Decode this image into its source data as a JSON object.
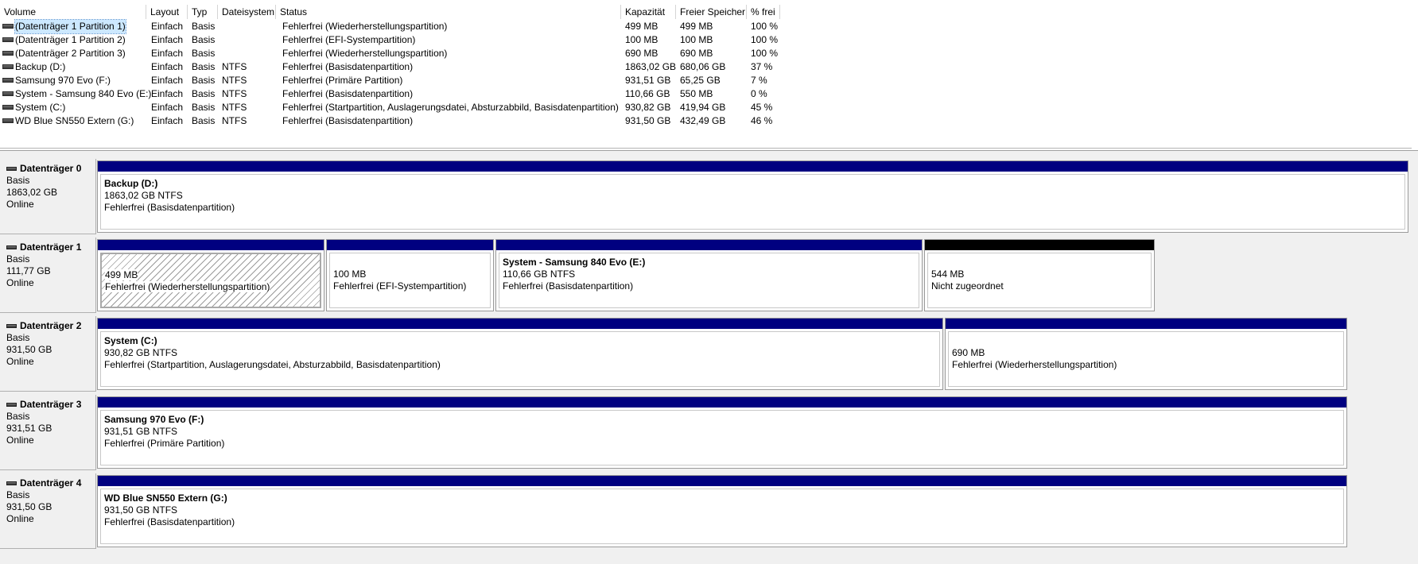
{
  "volume_list": {
    "columns": [
      "Volume",
      "Layout",
      "Typ",
      "Dateisystem",
      "Status",
      "Kapazität",
      "Freier Speicher",
      "% frei"
    ],
    "rows": [
      {
        "volume": "(Datenträger 1 Partition 1)",
        "layout": "Einfach",
        "typ": "Basis",
        "fs": "",
        "status": "Fehlerfrei (Wiederherstellungspartition)",
        "kapazitaet": "499 MB",
        "frei": "499 MB",
        "prozent": "100 %",
        "selected": true
      },
      {
        "volume": "(Datenträger 1 Partition 2)",
        "layout": "Einfach",
        "typ": "Basis",
        "fs": "",
        "status": "Fehlerfrei (EFI-Systempartition)",
        "kapazitaet": "100 MB",
        "frei": "100 MB",
        "prozent": "100 %"
      },
      {
        "volume": "(Datenträger 2 Partition 3)",
        "layout": "Einfach",
        "typ": "Basis",
        "fs": "",
        "status": "Fehlerfrei (Wiederherstellungspartition)",
        "kapazitaet": "690 MB",
        "frei": "690 MB",
        "prozent": "100 %"
      },
      {
        "volume": "Backup (D:)",
        "layout": "Einfach",
        "typ": "Basis",
        "fs": "NTFS",
        "status": "Fehlerfrei (Basisdatenpartition)",
        "kapazitaet": "1863,02 GB",
        "frei": "680,06 GB",
        "prozent": "37 %"
      },
      {
        "volume": "Samsung 970 Evo (F:)",
        "layout": "Einfach",
        "typ": "Basis",
        "fs": "NTFS",
        "status": "Fehlerfrei (Primäre Partition)",
        "kapazitaet": "931,51 GB",
        "frei": "65,25 GB",
        "prozent": "7 %"
      },
      {
        "volume": "System - Samsung 840 Evo (E:)",
        "layout": "Einfach",
        "typ": "Basis",
        "fs": "NTFS",
        "status": "Fehlerfrei (Basisdatenpartition)",
        "kapazitaet": "110,66 GB",
        "frei": "550 MB",
        "prozent": "0 %"
      },
      {
        "volume": "System (C:)",
        "layout": "Einfach",
        "typ": "Basis",
        "fs": "NTFS",
        "status": "Fehlerfrei (Startpartition, Auslagerungsdatei, Absturzabbild, Basisdatenpartition)",
        "kapazitaet": "930,82 GB",
        "frei": "419,94 GB",
        "prozent": "45 %"
      },
      {
        "volume": "WD Blue SN550 Extern (G:)",
        "layout": "Einfach",
        "typ": "Basis",
        "fs": "NTFS",
        "status": "Fehlerfrei (Basisdatenpartition)",
        "kapazitaet": "931,50 GB",
        "frei": "432,49 GB",
        "prozent": "46 %"
      }
    ]
  },
  "disks": [
    {
      "name": "Datenträger 0",
      "type": "Basis",
      "size": "1863,02 GB",
      "state": "Online",
      "partitions": [
        {
          "name": "Backup  (D:)",
          "size": "1863,02 GB NTFS",
          "status": "Fehlerfrei (Basisdatenpartition)",
          "band": "blue"
        }
      ]
    },
    {
      "name": "Datenträger 1",
      "type": "Basis",
      "size": "111,77 GB",
      "state": "Online",
      "partitions": [
        {
          "name": "",
          "size": "499 MB",
          "status": "Fehlerfrei (Wiederherstellungspartition)",
          "band": "blue",
          "selected": true
        },
        {
          "name": "",
          "size": "100 MB",
          "status": "Fehlerfrei (EFI-Systempartition)",
          "band": "blue"
        },
        {
          "name": "System - Samsung 840 Evo  (E:)",
          "size": "110,66 GB NTFS",
          "status": "Fehlerfrei (Basisdatenpartition)",
          "band": "blue"
        },
        {
          "name": "",
          "size": "544 MB",
          "status": "Nicht zugeordnet",
          "band": "black"
        }
      ]
    },
    {
      "name": "Datenträger 2",
      "type": "Basis",
      "size": "931,50 GB",
      "state": "Online",
      "partitions": [
        {
          "name": "System  (C:)",
          "size": "930,82 GB NTFS",
          "status": "Fehlerfrei (Startpartition, Auslagerungsdatei, Absturzabbild, Basisdatenpartition)",
          "band": "blue"
        },
        {
          "name": "",
          "size": "690 MB",
          "status": "Fehlerfrei (Wiederherstellungspartition)",
          "band": "blue"
        }
      ]
    },
    {
      "name": "Datenträger 3",
      "type": "Basis",
      "size": "931,51 GB",
      "state": "Online",
      "partitions": [
        {
          "name": "Samsung 970 Evo  (F:)",
          "size": "931,51 GB NTFS",
          "status": "Fehlerfrei (Primäre Partition)",
          "band": "blue"
        }
      ]
    },
    {
      "name": "Datenträger 4",
      "type": "Basis",
      "size": "931,50 GB",
      "state": "Online",
      "partitions": [
        {
          "name": "WD Blue SN550 Extern  (G:)",
          "size": "931,50 GB NTFS",
          "status": "Fehlerfrei (Basisdatenpartition)",
          "band": "blue"
        }
      ]
    }
  ]
}
